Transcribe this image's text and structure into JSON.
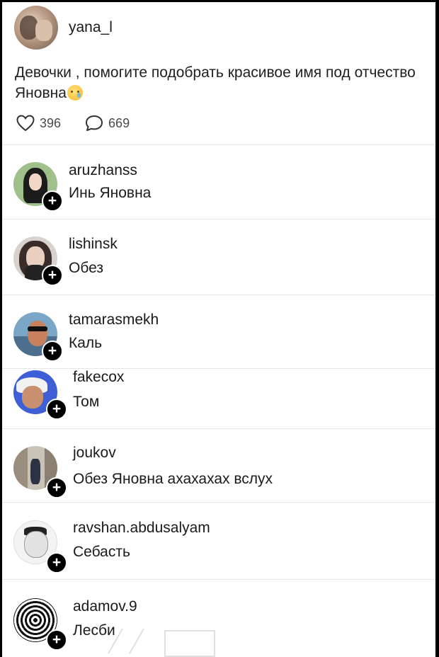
{
  "post": {
    "username": "yana_l",
    "text": "Девочки , помогите подобрать красивое имя под отчество Яновна",
    "emoji": "crying-face-emoji",
    "likes": "396",
    "replies": "669"
  },
  "comments": [
    {
      "username": "aruzhanss",
      "text": "Инь Яновна"
    },
    {
      "username": "lishinsk",
      "text": "Обез"
    },
    {
      "username": "tamarasmekh",
      "text": "Каль"
    },
    {
      "username": "fakecox",
      "text": "Том"
    },
    {
      "username": "joukov",
      "text": "Обез Яновна ахахахах вслух"
    },
    {
      "username": "ravshan.abdusalyam",
      "text": "Себасть"
    },
    {
      "username": "adamov.9",
      "text": "Лесби"
    }
  ],
  "icons": {
    "like": "heart-icon",
    "reply": "speech-bubble-icon",
    "follow": "plus-icon"
  },
  "follow_symbol": "+"
}
